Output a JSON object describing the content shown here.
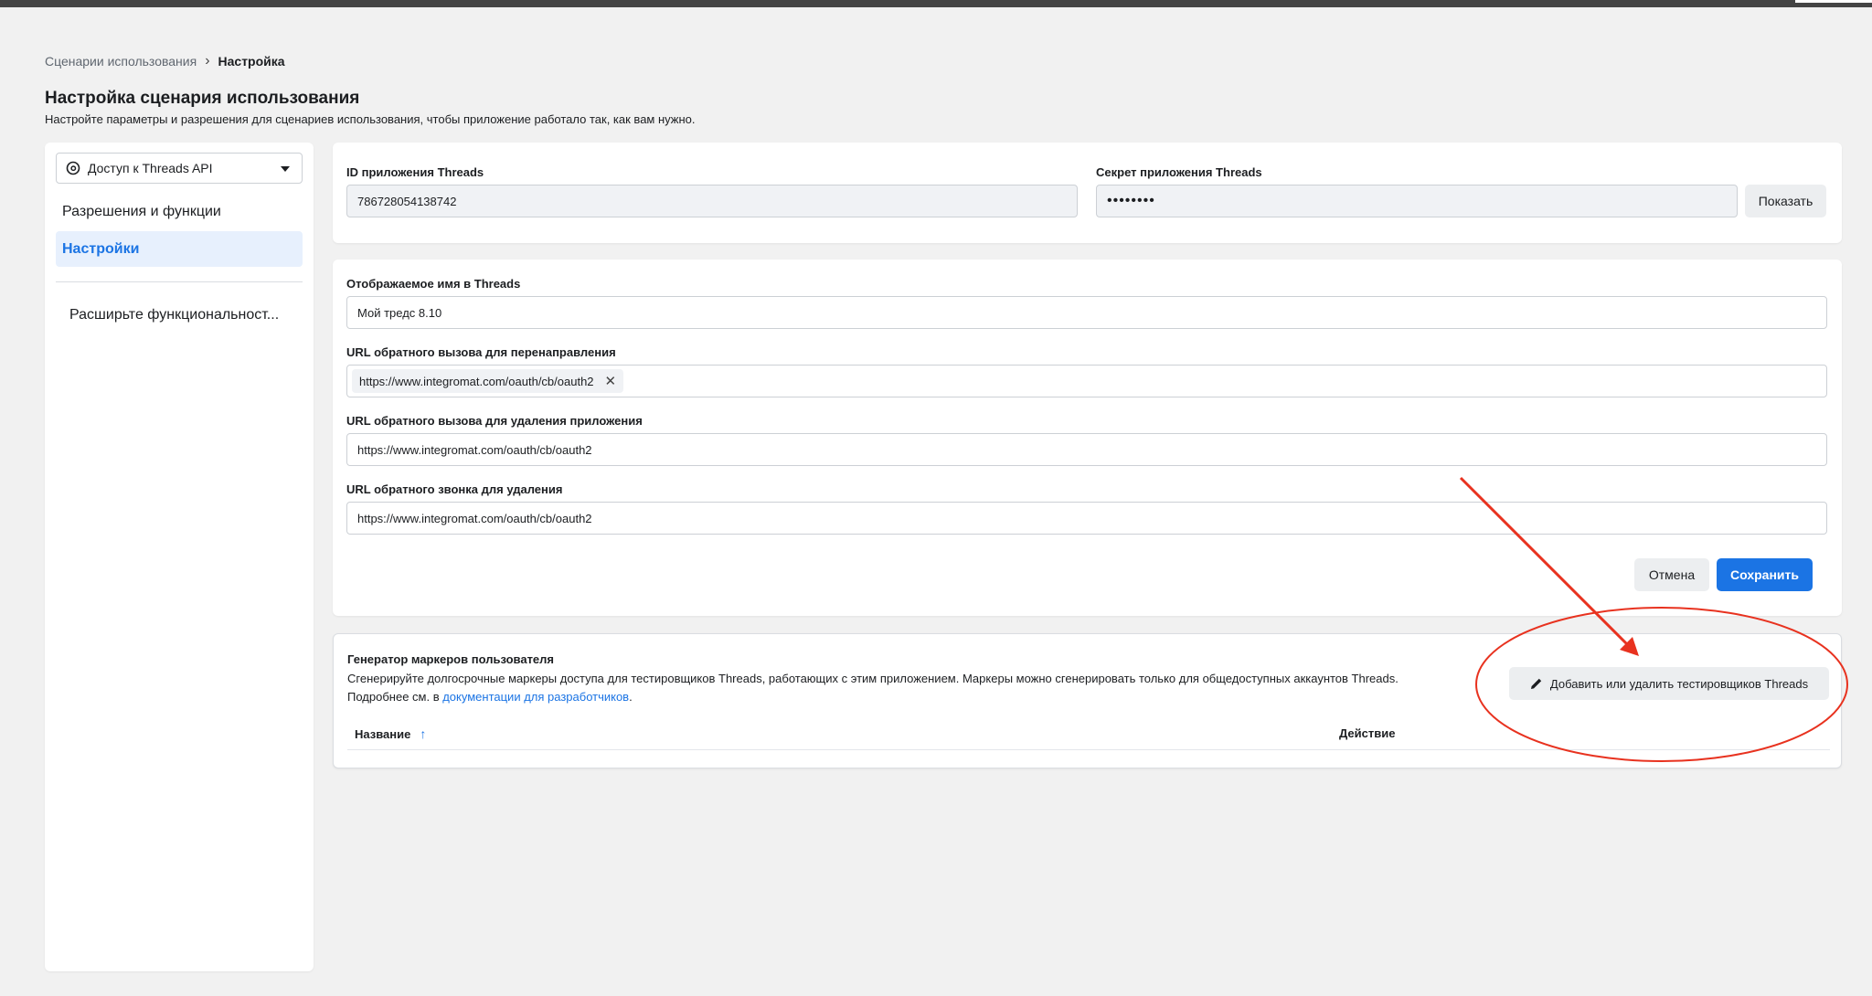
{
  "breadcrumb": {
    "parent": "Сценарии использования",
    "current": "Настройка"
  },
  "page": {
    "title": "Настройка сценария использования",
    "subtitle": "Настройте параметры и разрешения для сценариев использования, чтобы приложение работало так, как вам нужно."
  },
  "sidebar": {
    "select_value": "Доступ к Threads API",
    "items": [
      {
        "label": "Разрешения и функции",
        "active": false
      },
      {
        "label": "Настройки",
        "active": true
      }
    ],
    "extend_label": "Расширьте функциональност..."
  },
  "app_credentials": {
    "id_label": "ID приложения Threads",
    "id_value": "786728054138742",
    "secret_label": "Секрет приложения Threads",
    "secret_value": "••••••••",
    "show_button": "Показать"
  },
  "settings_form": {
    "display_name_label": "Отображаемое имя в Threads",
    "display_name_value": "Мой тредс 8.10",
    "redirect_label": "URL обратного вызова для перенаправления",
    "redirect_chip": "https://www.integromat.com/oauth/cb/oauth2",
    "uninstall_label": "URL обратного вызова для удаления приложения",
    "uninstall_value": "https://www.integromat.com/oauth/cb/oauth2",
    "delete_label": "URL обратного звонка для удаления",
    "delete_value": "https://www.integromat.com/oauth/cb/oauth2",
    "cancel_button": "Отмена",
    "save_button": "Сохранить"
  },
  "token_generator": {
    "title": "Генератор маркеров пользователя",
    "description": "Сгенерируйте долгосрочные маркеры доступа для тестировщиков Threads, работающих с этим приложением. Маркеры можно сгенерировать только для общедоступных аккаунтов Threads.",
    "more_prefix": "Подробнее см. в ",
    "docs_link": "документации для разработчиков",
    "more_suffix": ".",
    "add_testers_button": "Добавить или удалить тестировщиков Threads",
    "columns": [
      "Название",
      "Действие"
    ]
  },
  "colors": {
    "accent": "#1b74e4",
    "annotation": "#e8321f",
    "background": "#f1f1f1"
  },
  "icons": [
    "threads-icon",
    "chevron-right-icon",
    "caret-down-icon",
    "close-icon",
    "pencil-icon",
    "arrow-up-icon"
  ]
}
